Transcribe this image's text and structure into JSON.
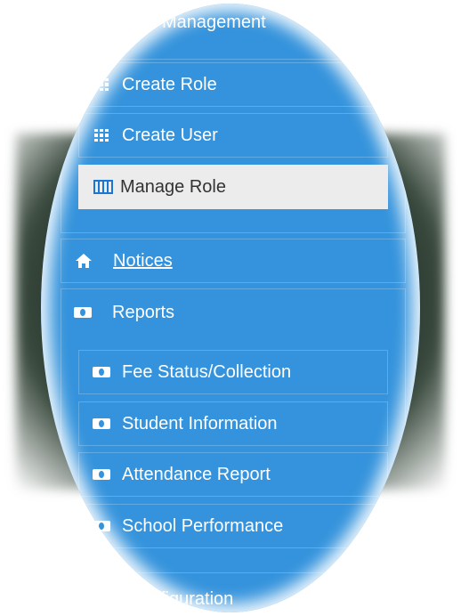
{
  "menu": {
    "management_label": "Management",
    "items": {
      "create_role": "Create Role",
      "create_user": "Create User",
      "manage_role": "Manage Role"
    },
    "notices": "Notices",
    "reports": {
      "label": "Reports",
      "sub_items": [
        "Fee Status/Collection",
        "Student Information",
        "Attendance Report",
        "School Performance"
      ]
    },
    "configuration_label": "figuration"
  },
  "colors": {
    "sidebar_blue": "#3493dc",
    "active_item_bg": "#ececec"
  }
}
